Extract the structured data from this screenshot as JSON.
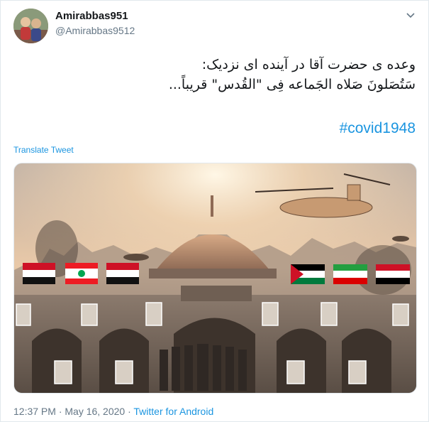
{
  "tweet": {
    "display_name": "Amirabbas951",
    "handle": "@Amirabbas9512",
    "text_lines": [
      "وعده ی حضرت آقا در آینده ای نزدیک:",
      "سَتُصَلونَ صَلاه الجَماعه فِی \"القُدس\" قریباً..."
    ],
    "hashtag": "#covid1948",
    "translate_label": "Translate Tweet",
    "timestamp": "12:37 PM · May 16, 2020",
    "separator": " · ",
    "source": "Twitter for Android"
  },
  "icons": {
    "caret": "chevron-down-icon",
    "avatar": "avatar-photo"
  },
  "colors": {
    "link": "#1b95e0",
    "secondary_text": "#657786",
    "primary_text": "#14171a",
    "border": "#e1e8ed"
  }
}
